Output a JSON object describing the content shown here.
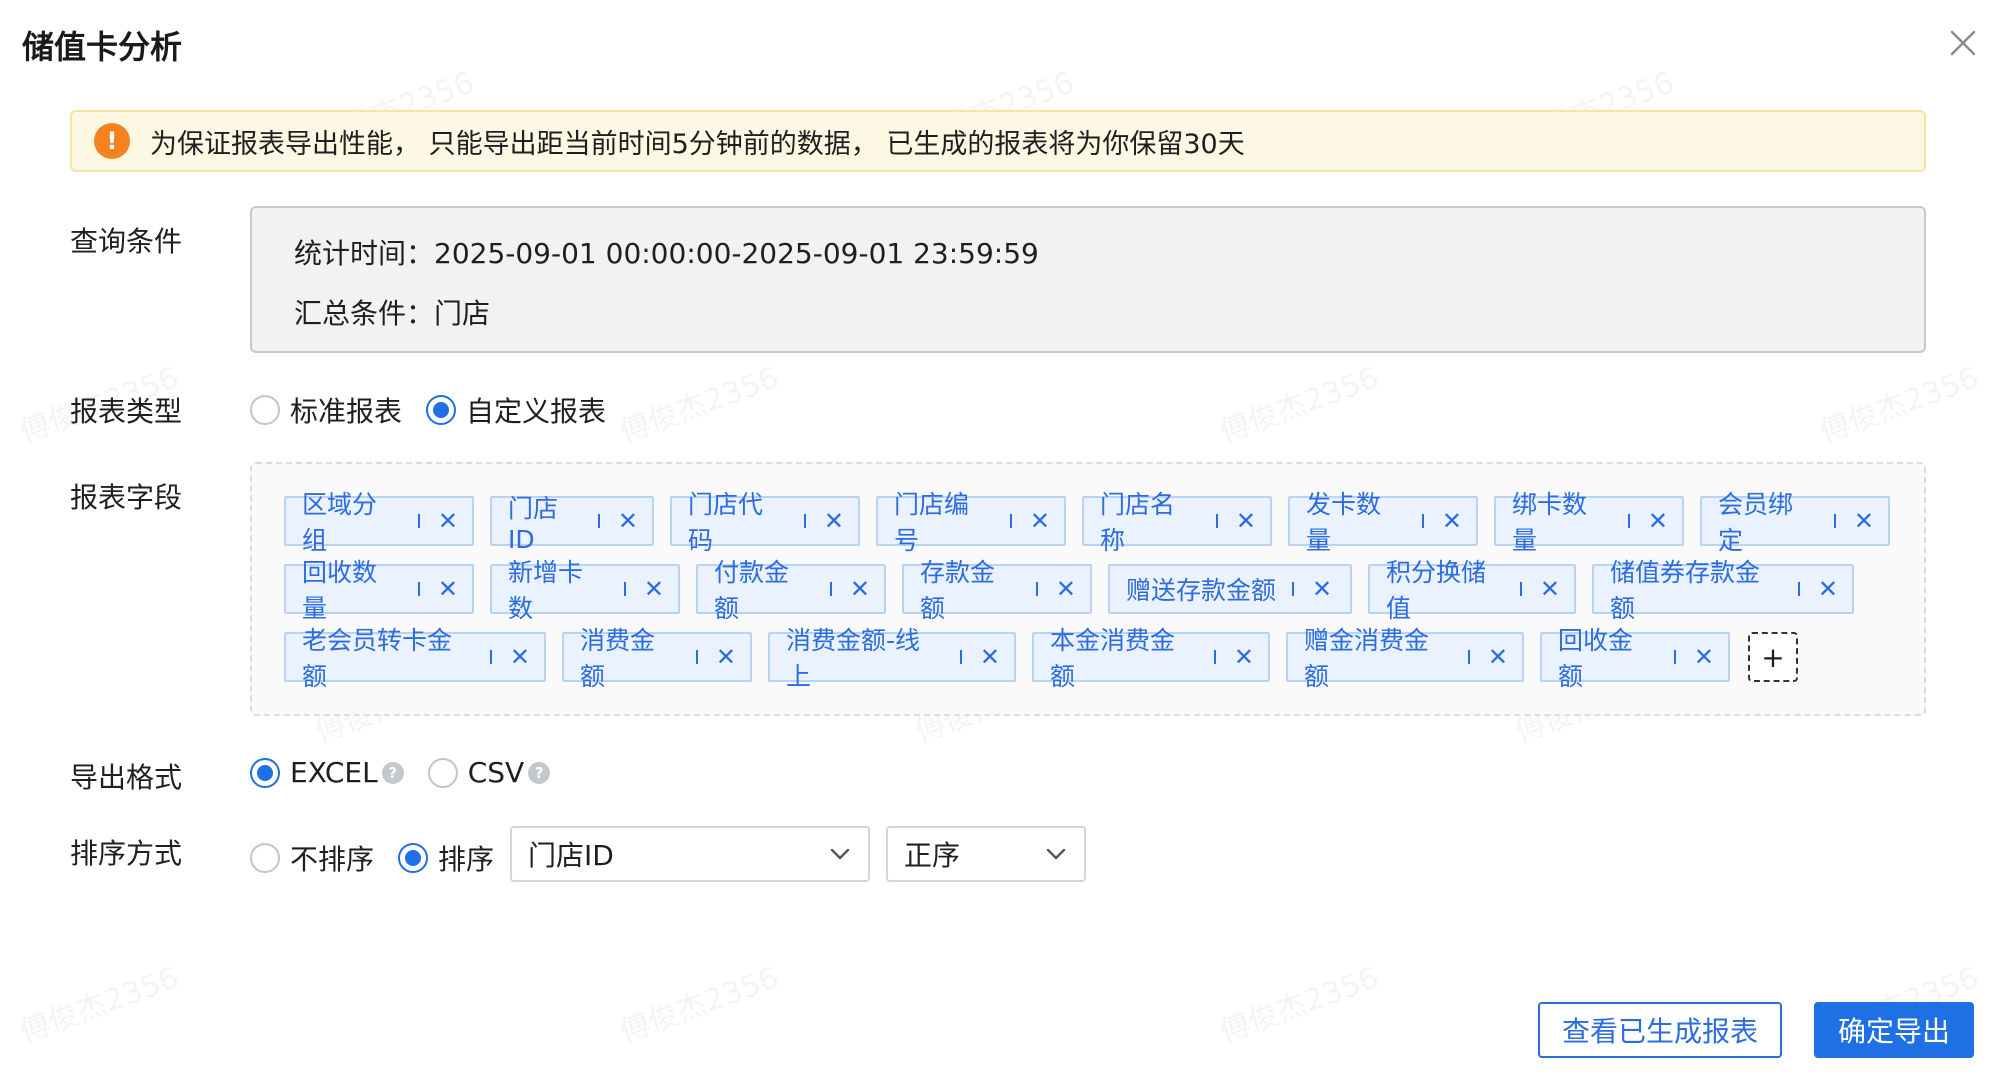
{
  "dialog": {
    "title": "储值卡分析"
  },
  "alert": {
    "text": "为保证报表导出性能， 只能导出距当前时间5分钟前的数据， 已生成的报表将为你保留30天"
  },
  "query": {
    "label": "查询条件",
    "time_text": "统计时间：2025-09-01 00:00:00-2025-09-01 23:59:59",
    "summary_text": "汇总条件：门店"
  },
  "report_type": {
    "label": "报表类型",
    "options": [
      "标准报表",
      "自定义报表"
    ],
    "selected": "自定义报表"
  },
  "fields": {
    "label": "报表字段",
    "tags": [
      "区域分组",
      "门店ID",
      "门店代码",
      "门店编号",
      "门店名称",
      "发卡数量",
      "绑卡数量",
      "会员绑定",
      "回收数量",
      "新增卡数",
      "付款金额",
      "存款金额",
      "赠送存款金额",
      "积分换储值",
      "储值券存款金额",
      "老会员转卡金额",
      "消费金额",
      "消费金额-线上",
      "本金消费金额",
      "赠金消费金额",
      "回收金额"
    ],
    "add_symbol": "+",
    "close_symbol": "✕"
  },
  "export_format": {
    "label": "导出格式",
    "options": [
      "EXCEL",
      "CSV"
    ],
    "selected": "EXCEL",
    "help_symbol": "?"
  },
  "sort": {
    "label": "排序方式",
    "options": [
      "不排序",
      "排序"
    ],
    "selected": "排序",
    "field_value": "门店ID",
    "order_value": "正序"
  },
  "buttons": {
    "view_generated": "查看已生成报表",
    "confirm_export": "确定导出"
  },
  "alert_icon_symbol": "!",
  "watermark_text": "傅俊杰2356",
  "colors": {
    "primary": "#1f6fe5",
    "warning": "#f58220",
    "tag_bg": "#eaf2fe"
  }
}
